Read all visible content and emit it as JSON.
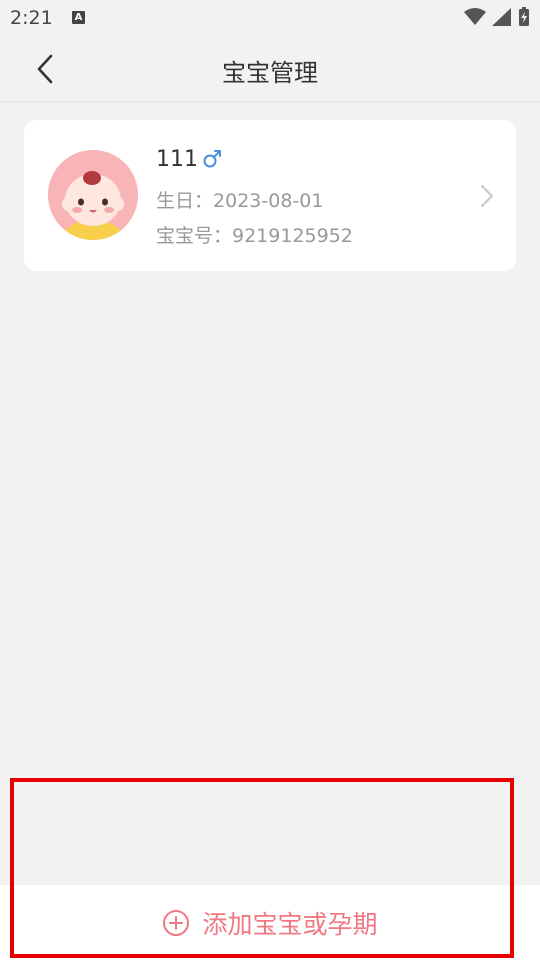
{
  "status_bar": {
    "time": "2:21",
    "notification_letter": "A"
  },
  "header": {
    "title": "宝宝管理",
    "back_icon": "chevron-left-icon"
  },
  "baby_card": {
    "name": "111",
    "gender_symbol": "♂",
    "gender_color": "#4a90e2",
    "birthday_label": "生日：",
    "birthday_value": "2023-08-01",
    "id_label": "宝宝号：",
    "id_value": "9219125952"
  },
  "footer": {
    "add_label": "添加宝宝或孕期",
    "accent_color": "#f07883"
  },
  "colors": {
    "background": "#f2f2f2",
    "card": "#ffffff",
    "highlight": "#e60000"
  }
}
